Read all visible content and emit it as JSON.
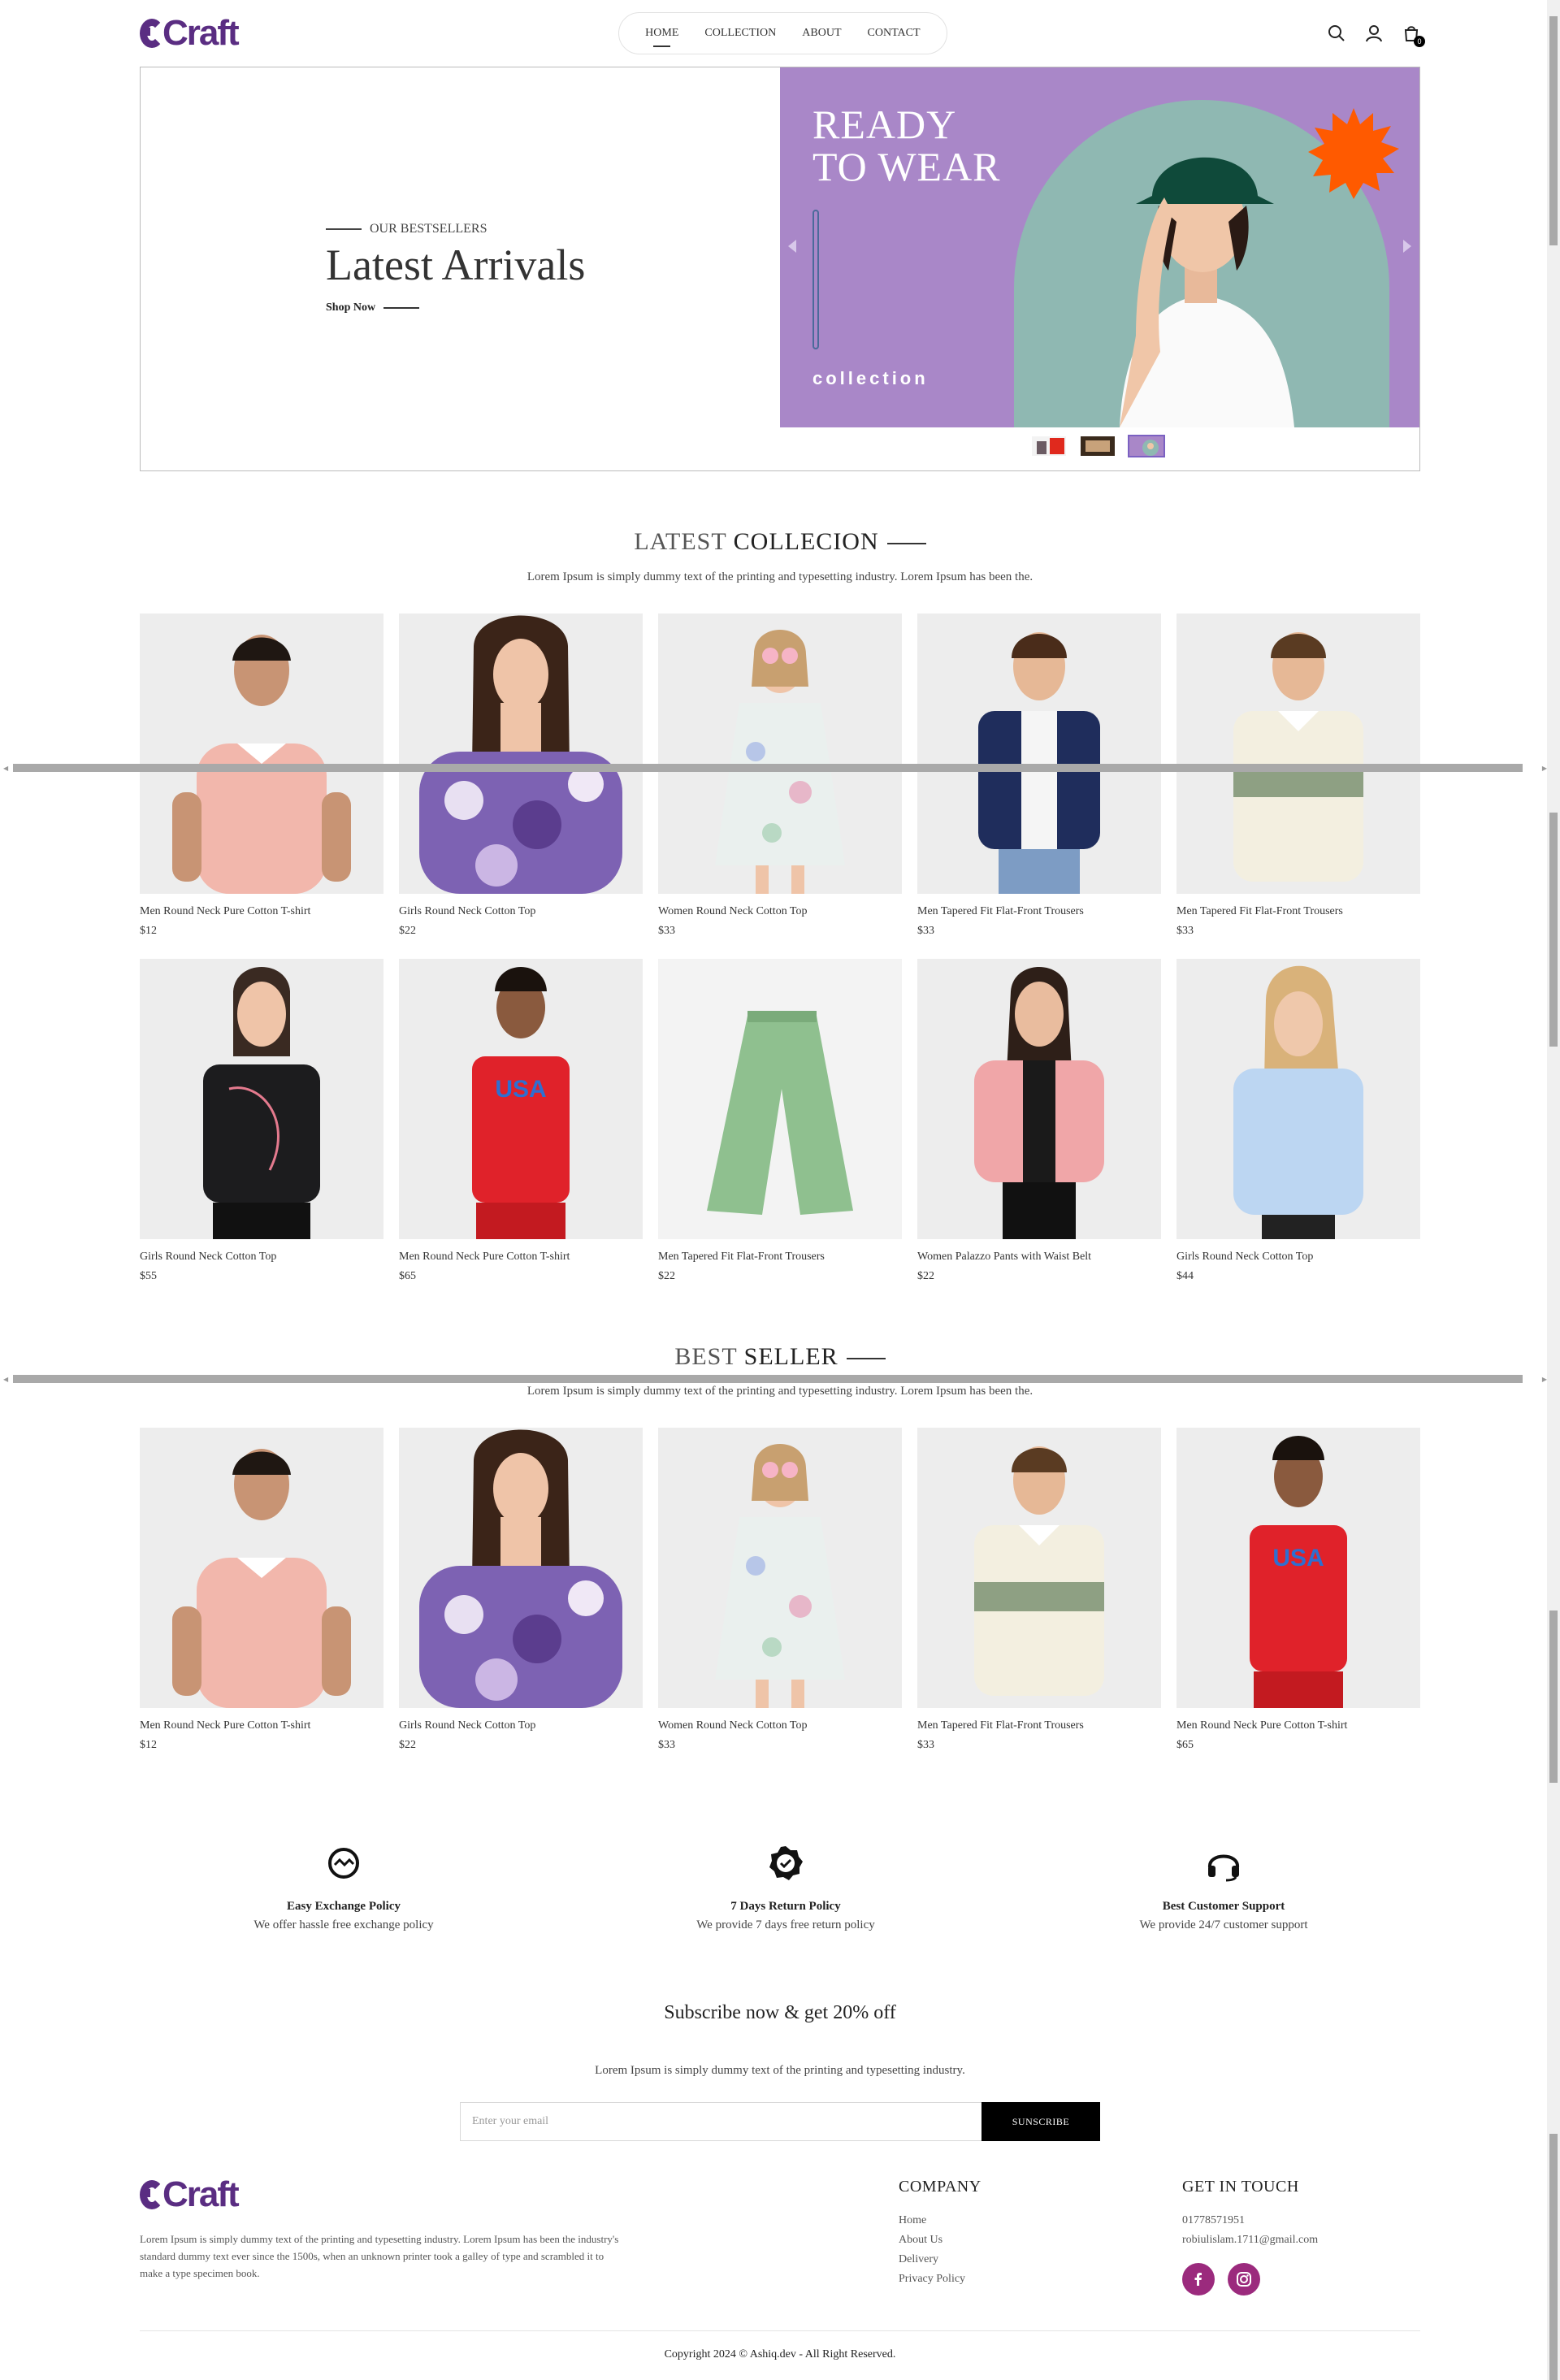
{
  "brand": {
    "logo_text": "Craft",
    "color": "#5a2d82"
  },
  "nav": {
    "items": [
      "HOME",
      "COLLECTION",
      "ABOUT",
      "CONTACT"
    ],
    "active": "HOME",
    "cart_count": "0"
  },
  "hero": {
    "eyebrow": "OUR BESTSELLERS",
    "title": "Latest Arrivals",
    "cta": "Shop Now",
    "banner_line1": "READY",
    "banner_line2": "TO WEAR",
    "banner_tag": "collection",
    "banner_bg": "#a987c8",
    "accent": "#ff5a00"
  },
  "latest": {
    "title_light": "LATEST",
    "title_dark": "COLLECION",
    "subtitle": "Lorem Ipsum is simply dummy text of the printing and typesetting industry. Lorem Ipsum has been the.",
    "products": [
      {
        "name": "Men Round Neck Pure Cotton T-shirt",
        "price": "$12"
      },
      {
        "name": "Girls Round Neck Cotton Top",
        "price": "$22"
      },
      {
        "name": "Women Round Neck Cotton Top",
        "price": "$33"
      },
      {
        "name": "Men Tapered Fit Flat-Front Trousers",
        "price": "$33"
      },
      {
        "name": "Men Tapered Fit Flat-Front Trousers",
        "price": "$33"
      },
      {
        "name": "Girls Round Neck Cotton Top",
        "price": "$55"
      },
      {
        "name": "Men Round Neck Pure Cotton T-shirt",
        "price": "$65"
      },
      {
        "name": "Men Tapered Fit Flat-Front Trousers",
        "price": "$22"
      },
      {
        "name": "Women Palazzo Pants with Waist Belt",
        "price": "$22"
      },
      {
        "name": "Girls Round Neck Cotton Top",
        "price": "$44"
      }
    ]
  },
  "best": {
    "title_light": "BEST",
    "title_dark": "SELLER",
    "subtitle": "Lorem Ipsum is simply dummy text of the printing and typesetting industry. Lorem Ipsum has been the.",
    "products": [
      {
        "name": "Men Round Neck Pure Cotton T-shirt",
        "price": "$12"
      },
      {
        "name": "Girls Round Neck Cotton Top",
        "price": "$22"
      },
      {
        "name": "Women Round Neck Cotton Top",
        "price": "$33"
      },
      {
        "name": "Men Tapered Fit Flat-Front Trousers",
        "price": "$33"
      },
      {
        "name": "Men Round Neck Pure Cotton T-shirt",
        "price": "$65"
      }
    ]
  },
  "features": [
    {
      "icon": "exchange-icon",
      "title": "Easy Exchange Policy",
      "desc": "We offer hassle free exchange policy"
    },
    {
      "icon": "verified-badge-icon",
      "title": "7 Days Return Policy",
      "desc": "We provide 7 days free return policy"
    },
    {
      "icon": "headset-icon",
      "title": "Best Customer Support",
      "desc": "We provide 24/7 customer support"
    }
  ],
  "subscribe": {
    "title": "Subscribe now & get 20% off",
    "text": "Lorem Ipsum is simply dummy text of the printing and typesetting industry.",
    "placeholder": "Enter your email",
    "button": "SUNSCRIBE"
  },
  "footer": {
    "description": "Lorem Ipsum is simply dummy text of the printing and typesetting industry. Lorem Ipsum has been the industry's standard dummy text ever since the 1500s, when an unknown printer took a galley of type and scrambled it to make a type specimen book.",
    "company_title": "COMPANY",
    "company_links": [
      "Home",
      "About Us",
      "Delivery",
      "Privacy Policy"
    ],
    "contact_title": "GET IN TOUCH",
    "phone": "01778571951",
    "email": "robiulislam.1711@gmail.com",
    "social_color": "#9b2a7d",
    "copyright": "Copyright 2024 © Ashiq.dev - All Right Reserved."
  }
}
